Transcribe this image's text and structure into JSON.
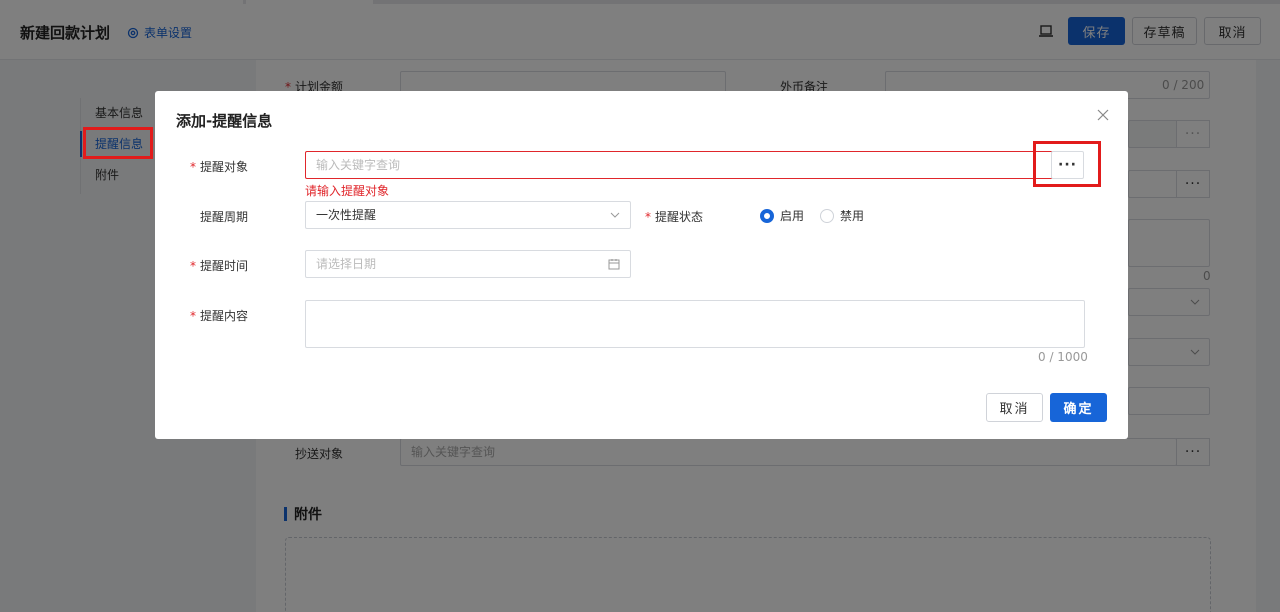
{
  "header": {
    "title": "新建回款计划",
    "form_settings": "表单设置",
    "save": "保存",
    "draft": "存草稿",
    "cancel": "取消"
  },
  "sidebar": {
    "items": [
      {
        "label": "基本信息"
      },
      {
        "label": "提醒信息"
      },
      {
        "label": "附件"
      }
    ]
  },
  "background_form": {
    "plan_amount_label": "计划金额",
    "fx_note_label": "外币备注",
    "fx_note_counter": "0 / 200",
    "side_counter": "0",
    "cc_label": "抄送对象",
    "cc_placeholder": "输入关键字查询",
    "attachments_title": "附件",
    "dots": "···"
  },
  "modal": {
    "title": "添加-提醒信息",
    "target_label": "提醒对象",
    "target_placeholder": "输入关键字查询",
    "target_error": "请输入提醒对象",
    "dots": "···",
    "cycle_label": "提醒周期",
    "cycle_value": "一次性提醒",
    "status_label": "提醒状态",
    "status_on": "启用",
    "status_off": "禁用",
    "time_label": "提醒时间",
    "time_placeholder": "请选择日期",
    "content_label": "提醒内容",
    "content_counter": "0 / 1000",
    "cancel": "取消",
    "ok": "确定"
  },
  "colors": {
    "primary": "#1765d8",
    "error": "#e0262b",
    "highlight": "#e21b1b"
  }
}
